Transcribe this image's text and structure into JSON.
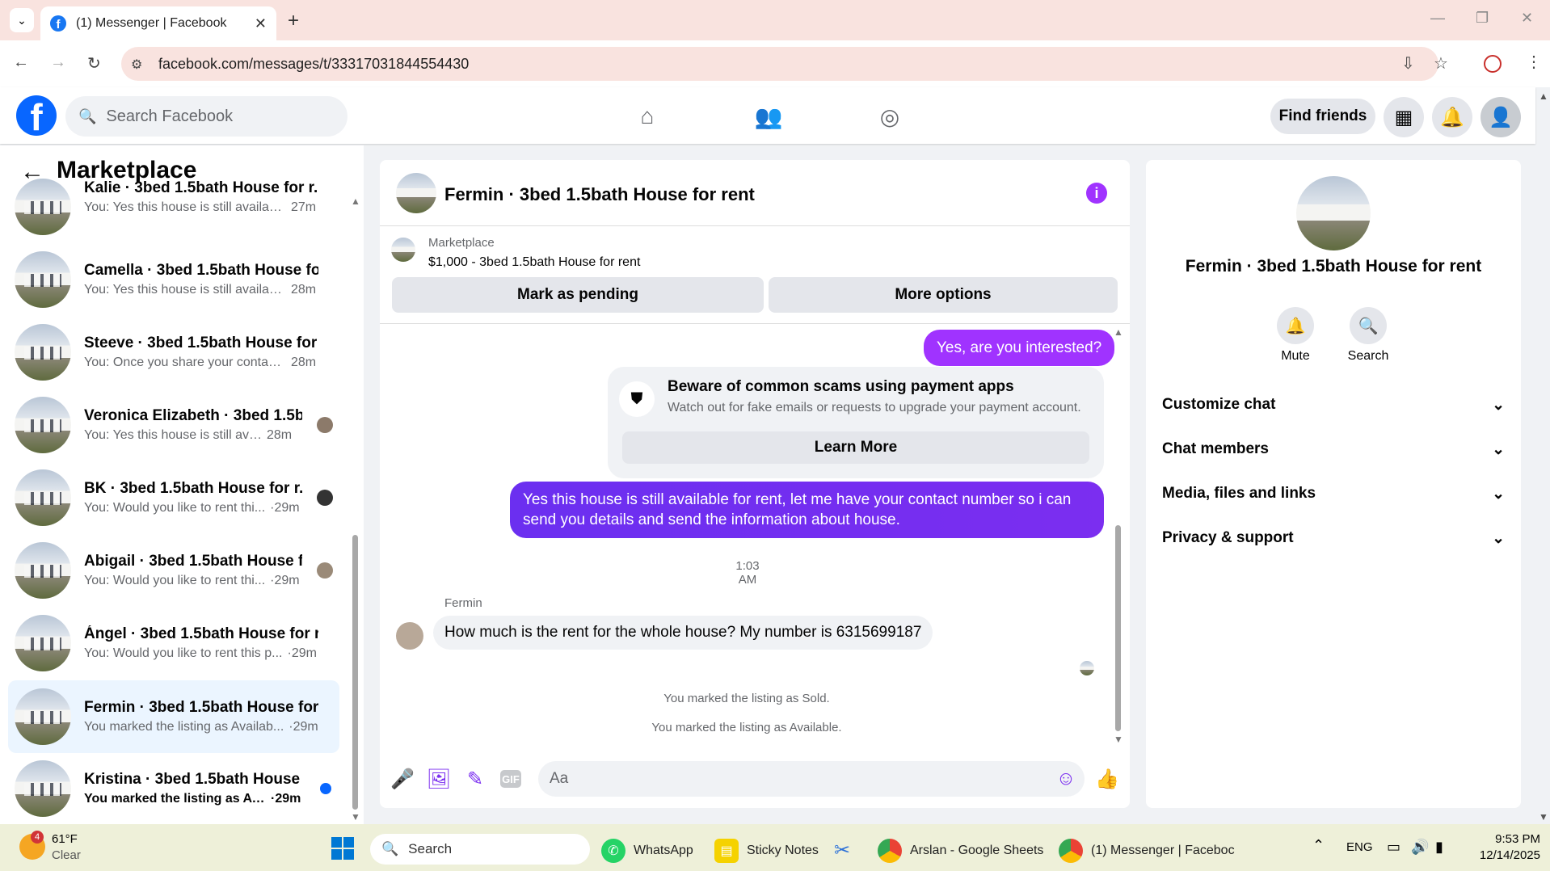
{
  "browser": {
    "tab_title": "(1) Messenger | Facebook",
    "url": "facebook.com/messages/t/33317031844554430"
  },
  "fb_header": {
    "search_placeholder": "Search Facebook",
    "find_friends": "Find friends"
  },
  "left_panel": {
    "title": "Marketplace",
    "conversations": [
      {
        "name": "Kalie · 3bed 1.5bath House for r...",
        "snippet": "You: Yes this house is still availabl...",
        "time": "27m"
      },
      {
        "name": "Camella · 3bed 1.5bath House fo...",
        "snippet": "You: Yes this house is still availabl...",
        "time": "28m"
      },
      {
        "name": "Steeve · 3bed 1.5bath House for ...",
        "snippet": "You: Once you share your contact...",
        "time": "28m"
      },
      {
        "name": "Veronica Elizabeth · 3bed 1.5b...",
        "snippet": "You: Yes this house is still avail...",
        "time": "28m"
      },
      {
        "name": "BK · 3bed 1.5bath House for r...",
        "snippet": "You: Would you like to rent thi...",
        "time": "·29m"
      },
      {
        "name": "Abigail · 3bed 1.5bath House f...",
        "snippet": "You: Would you like to rent thi...",
        "time": "·29m"
      },
      {
        "name": "Ángel · 3bed 1.5bath House for r...",
        "snippet": "You: Would you like to rent this p...",
        "time": "·29m"
      },
      {
        "name": "Fermin · 3bed 1.5bath House for...",
        "snippet": "You marked the listing as Availab...",
        "time": "·29m"
      },
      {
        "name": "Kristina · 3bed 1.5bath House f...",
        "snippet": "You marked the listing as Avai...",
        "time": "·29m"
      }
    ]
  },
  "chat": {
    "title": "Fermin · 3bed 1.5bath House for rent",
    "marketplace_label": "Marketplace",
    "listing": "$1,000 - 3bed 1.5bath House for rent",
    "mark_pending": "Mark as pending",
    "more_options": "More options",
    "msg_out_1": "Yes, are you interested?",
    "scam_title": "Beware of common scams using payment apps",
    "scam_sub": "Watch out for fake emails or requests to upgrade your payment account.",
    "learn_more": "Learn More",
    "msg_out_2_line1": "Yes this house is still available for rent, let me have your contact number so i can",
    "msg_out_2_line2": "send you details and send the information about house.",
    "timestamp": "1:03 AM",
    "sender": "Fermin",
    "msg_in": "How much is the rent for the whole house? My number is 6315699187",
    "sys_sold": "You marked the listing as Sold.",
    "sys_available": "You marked the listing as Available.",
    "composer_placeholder": "Aa"
  },
  "right_panel": {
    "name": "Fermin · 3bed 1.5bath House for rent",
    "mute": "Mute",
    "search": "Search",
    "sections": [
      "Customize chat",
      "Chat members",
      "Media, files and links",
      "Privacy & support"
    ]
  },
  "taskbar": {
    "weather_temp": "61°F",
    "weather_cond": "Clear",
    "weather_badge": "4",
    "search": "Search",
    "apps": [
      "WhatsApp",
      "Sticky Notes",
      "Arslan - Google Sheets",
      "(1) Messenger | Faceboc"
    ],
    "lang": "ENG",
    "time": "9:53 PM",
    "date": "12/14/2025"
  },
  "colors": {
    "accent": "#a033ff",
    "fb_blue": "#0866ff",
    "out_bubble": "#7b2ef0"
  }
}
